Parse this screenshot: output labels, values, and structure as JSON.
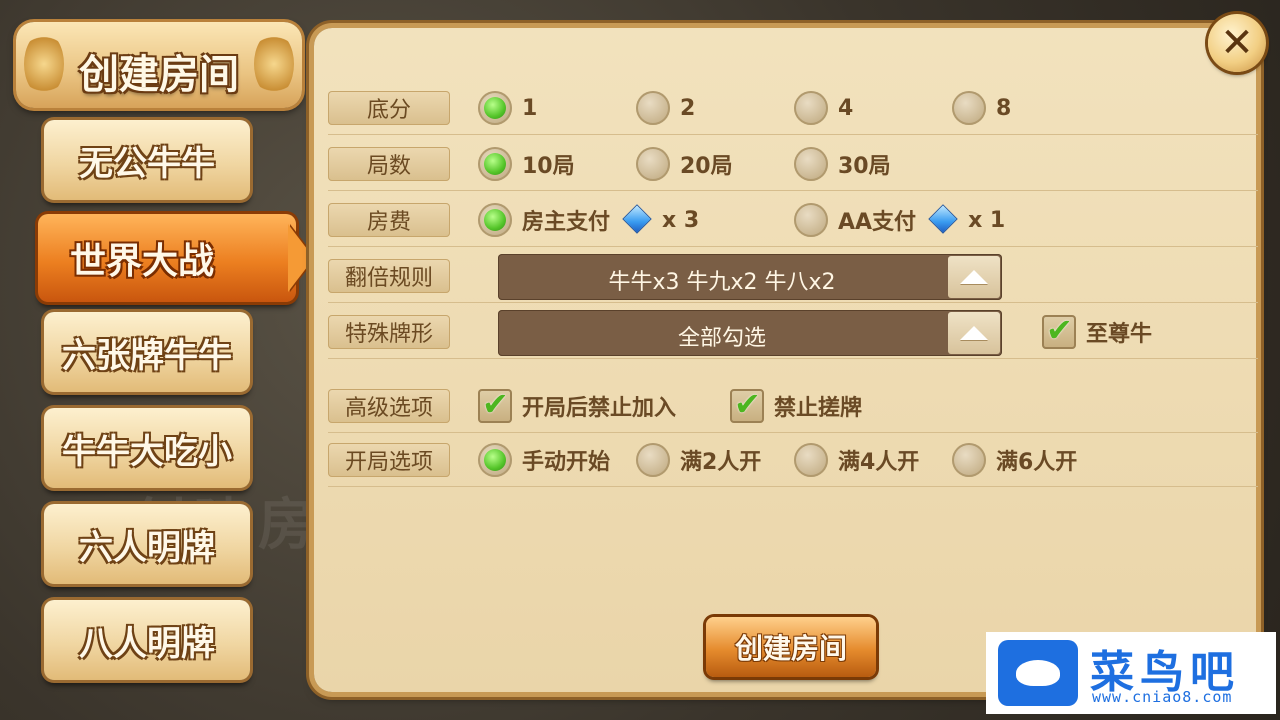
{
  "header": {
    "title": "创建房间"
  },
  "close": {
    "icon": "close-icon"
  },
  "menu": [
    {
      "label": "无公牛牛",
      "active": false
    },
    {
      "label": "世界大战",
      "active": true
    },
    {
      "label": "六张牌牛牛",
      "active": false
    },
    {
      "label": "牛牛大吃小",
      "active": false
    },
    {
      "label": "六人明牌",
      "active": false
    },
    {
      "label": "八人明牌",
      "active": false
    }
  ],
  "settings": {
    "base_score": {
      "label": "底分",
      "options": [
        "1",
        "2",
        "4",
        "8"
      ],
      "selected": "1"
    },
    "rounds": {
      "label": "局数",
      "options": [
        "10局",
        "20局",
        "30局"
      ],
      "selected": "10局"
    },
    "fee": {
      "label": "房费",
      "options": [
        {
          "text": "房主支付",
          "cost": "x 3",
          "icon": "diamond-icon"
        },
        {
          "text": "AA支付",
          "cost": "x 1",
          "icon": "diamond-icon"
        }
      ],
      "selected": "房主支付"
    },
    "double_rule": {
      "label": "翻倍规则",
      "value": "牛牛x3 牛九x2 牛八x2"
    },
    "special": {
      "label": "特殊牌形",
      "value": "全部勾选",
      "checkbox_label": "至尊牛",
      "checked": true
    },
    "advanced": {
      "label": "高级选项",
      "options": [
        {
          "text": "开局后禁止加入",
          "checked": true
        },
        {
          "text": "禁止搓牌",
          "checked": true
        }
      ]
    },
    "start": {
      "label": "开局选项",
      "options": [
        "手动开始",
        "满2人开",
        "满4人开",
        "满6人开"
      ],
      "selected": "手动开始"
    }
  },
  "create_button": "创建房间",
  "watermark": {
    "name": "菜鸟吧",
    "url": "www.cniao8.com"
  },
  "background_text": "创建房间"
}
